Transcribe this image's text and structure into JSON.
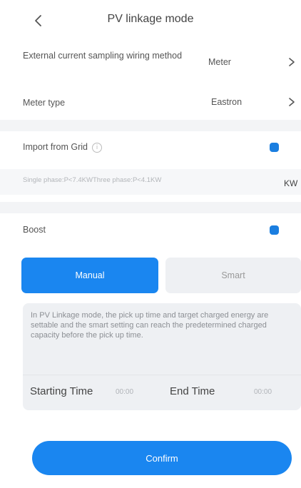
{
  "header": {
    "title": "PV linkage mode"
  },
  "settings": {
    "sampling_label": "External current sampling wiring method",
    "sampling_value": "Meter",
    "meter_type_label": "Meter type",
    "meter_type_value": "Eastron",
    "import_grid_label": "Import from Grid",
    "import_grid_on": true,
    "power_placeholder": "Single phase:P<7.4KWThree phase:P<4.1KW",
    "power_unit": "KW",
    "boost_label": "Boost",
    "boost_on": true
  },
  "mode": {
    "manual_label": "Manual",
    "smart_label": "Smart",
    "selected": "Manual"
  },
  "info": {
    "description": "In PV Linkage mode, the pick up time and target charged energy are settable and the smart setting can reach the predetermined charged capacity before the pick up time.",
    "start_label": "Starting Time",
    "start_value": "00:00",
    "end_label": "End Time",
    "end_value": "00:00"
  },
  "footer": {
    "confirm_label": "Confirm"
  },
  "colors": {
    "accent": "#1a86f0",
    "toggle": "#1a7ee0",
    "inactive_bg": "#eef0f3"
  }
}
